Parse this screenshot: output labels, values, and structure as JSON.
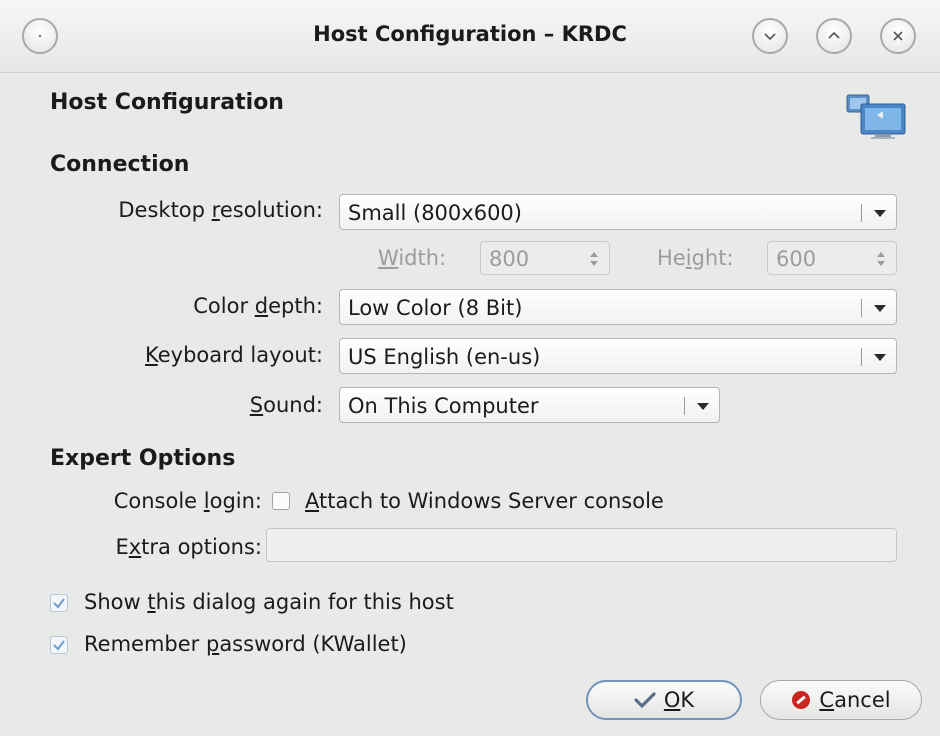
{
  "window": {
    "title": "Host Configuration – KRDC"
  },
  "header": {
    "title": "Host Configuration",
    "icon": "remote-desktop-icon"
  },
  "connection": {
    "heading": "Connection",
    "resolution": {
      "label_pre": "Desktop ",
      "label_key": "r",
      "label_post": "esolution:",
      "value": "Small (800x600)"
    },
    "width": {
      "label_key": "W",
      "label_post": "idth:",
      "value": "800"
    },
    "height": {
      "label_pre": "He",
      "label_key": "i",
      "label_post": "ght:",
      "value": "600"
    },
    "color_depth": {
      "label_pre": "Color ",
      "label_key": "d",
      "label_post": "epth:",
      "value": "Low Color (8 Bit)"
    },
    "keyboard": {
      "label_key": "K",
      "label_post": "eyboard layout:",
      "value": "US English (en-us)"
    },
    "sound": {
      "label_key": "S",
      "label_post": "ound:",
      "value": "On This Computer"
    }
  },
  "expert": {
    "heading": "Expert Options",
    "console": {
      "label_pre": "Console ",
      "label_key": "l",
      "label_post": "ogin:",
      "checkbox_key": "A",
      "checkbox_post": "ttach to Windows Server console"
    },
    "extra": {
      "label_pre": "E",
      "label_key": "x",
      "label_post": "tra options:",
      "value": ""
    }
  },
  "options": {
    "show_dialog": {
      "pre": "Show ",
      "key": "t",
      "post": "his dialog again for this host",
      "checked": true
    },
    "remember_pw": {
      "pre": "Remember ",
      "key": "p",
      "post": "assword (KWallet)",
      "checked": true
    }
  },
  "buttons": {
    "ok": {
      "key": "O",
      "post": "K"
    },
    "cancel": {
      "key": "C",
      "post": "ancel"
    }
  },
  "colors": {
    "accent": "#6f95bd",
    "cancel_red": "#c9261f",
    "check_blue": "#6a9ccc"
  }
}
